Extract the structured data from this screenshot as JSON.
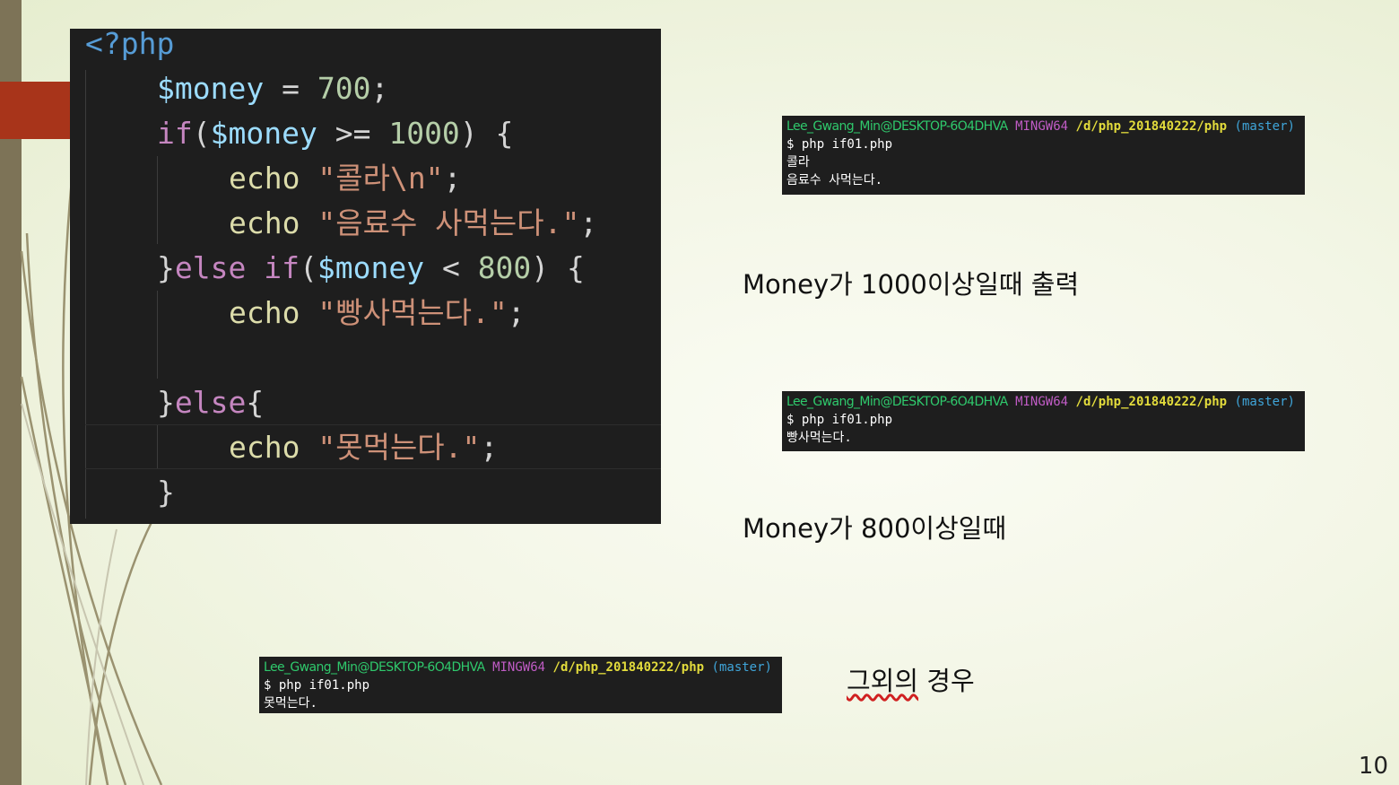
{
  "code": {
    "open_tag": "<?php",
    "l1": {
      "var": "$money",
      "eq": " = ",
      "num": "700",
      "end": ";"
    },
    "l2": {
      "kw": "if",
      "p1": "(",
      "var": "$money",
      "op": " >= ",
      "num": "1000",
      "p2": ") {"
    },
    "l3": {
      "fn": "echo",
      "str": "\"콜라\\n\"",
      "end": ";"
    },
    "l4": {
      "fn": "echo",
      "str": "\"음료수 사먹는다.\"",
      "end": ";"
    },
    "l5": {
      "brace": "}",
      "kw1": "else",
      "kw2": "if",
      "p1": "(",
      "var": "$money",
      "op": " < ",
      "num": "800",
      "p2": ") {"
    },
    "l6": {
      "fn": "echo",
      "str": "\"빵사먹는다.\"",
      "end": ";"
    },
    "l8": {
      "brace": "}",
      "kw": "else",
      "p": "{"
    },
    "l9": {
      "fn": "echo",
      "str": "\"못먹는다.\"",
      "end": ";"
    },
    "l10": {
      "brace": "}"
    }
  },
  "terminal_prompt": {
    "user": "Lee_Gwang_Min@DESKTOP-6O4DHVA",
    "host": "MINGW64",
    "path": "/d/php_201840222/php",
    "branch": "(master)",
    "command": "$ php if01.php"
  },
  "terminal1": {
    "out1": "콜라",
    "out2": "음료수 사먹는다."
  },
  "terminal2": {
    "out1": "빵사먹는다."
  },
  "terminal3": {
    "out1": "못먹는다."
  },
  "captions": {
    "c1": "Money가 1000이상일때 출력",
    "c2": "Money가 800이상일때",
    "c3": "그외의",
    "c3b": " 경우"
  },
  "page_number": "10",
  "colors": {
    "accent": "#a8341a",
    "band": "#7d7357",
    "editor_bg": "#1e1e1e",
    "keyword": "#c586c0",
    "variable": "#9cdcfe",
    "number": "#b5cea8",
    "function": "#dcdcaa",
    "string": "#ce9178"
  }
}
